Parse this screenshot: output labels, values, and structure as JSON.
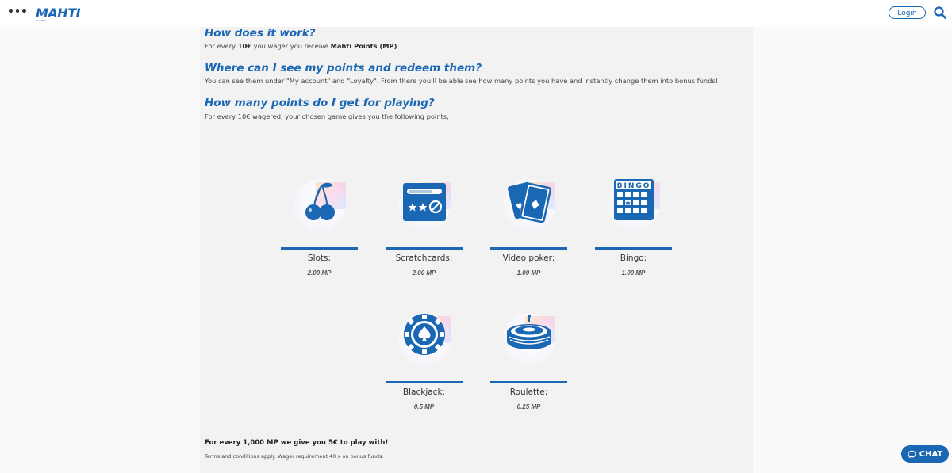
{
  "header": {
    "logo_text": "MAHTI",
    "logo_subtext": "CASINO",
    "login_label": "Login",
    "menu_icon": "more-dots-icon",
    "search_icon": "search-icon"
  },
  "faq": [
    {
      "question": "How does it work?",
      "answer_parts": [
        "For every ",
        "10€",
        " you wager you receive ",
        "Mahti Points (MP)",
        "."
      ]
    },
    {
      "question": "Where can I see my points and redeem them?",
      "answer": "You can see them under \"My account\" and \"Loyalty\". From there you'll be able see how many points you have and instantly change them into bonus funds!"
    },
    {
      "question": "How many points do I get for playing?",
      "answer": "For every 10€ wagered, your chosen game gives you the following points;"
    }
  ],
  "games": [
    {
      "name": "Slots:",
      "points": "2.00 MP",
      "icon": "cherries-icon"
    },
    {
      "name": "Scratchcards:",
      "points": "2.00 MP",
      "icon": "scratchcard-icon"
    },
    {
      "name": "Video poker:",
      "points": "1.00 MP",
      "icon": "playing-cards-icon"
    },
    {
      "name": "Bingo:",
      "points": "1.00 MP",
      "icon": "bingo-card-icon"
    },
    {
      "name": "Blackjack:",
      "points": "0.5 MP",
      "icon": "poker-chip-icon"
    },
    {
      "name": "Roulette:",
      "points": "0.25 MP",
      "icon": "roulette-wheel-icon"
    }
  ],
  "promo": "For every 1,000 MP we give you 5€ to play with!",
  "terms": "Terms and conditions apply. Wager requirement 40 x on bonus funds.",
  "chat": {
    "label": "CHAT",
    "icon": "chat-bubble-icon"
  },
  "colors": {
    "accent": "#1a67b3",
    "page_bg": "#fafafa",
    "panel_bg": "#f2f2f2"
  }
}
